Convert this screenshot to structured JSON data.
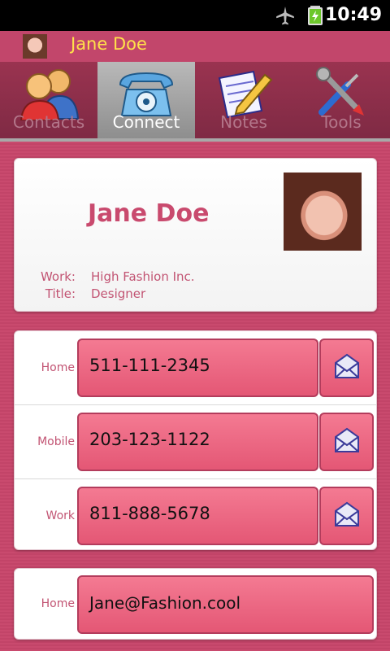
{
  "status": {
    "time": "10:49"
  },
  "header": {
    "title": "Jane Doe"
  },
  "tabs": [
    {
      "label": "Contacts",
      "icon": "people-icon",
      "active": false
    },
    {
      "label": "Connect",
      "icon": "telephone-icon",
      "active": true
    },
    {
      "label": "Notes",
      "icon": "notepad-pencil-icon",
      "active": false
    },
    {
      "label": "Tools",
      "icon": "wrench-screwdriver-icon",
      "active": false
    }
  ],
  "profile": {
    "name": "Jane Doe",
    "work_label": "Work:",
    "work_value": "High Fashion Inc.",
    "title_label": "Title:",
    "title_value": "Designer"
  },
  "phones": [
    {
      "type": "Home",
      "number": "511-111-2345"
    },
    {
      "type": "Mobile",
      "number": "203-123-1122"
    },
    {
      "type": "Work",
      "number": "811-888-5678"
    }
  ],
  "email": {
    "type": "Home",
    "address": "Jane@Fashion.cool"
  },
  "colors": {
    "background": "#c94a6e",
    "title_text": "#ffe14a",
    "accent_text": "#c94a6e",
    "button": "#e45775"
  }
}
